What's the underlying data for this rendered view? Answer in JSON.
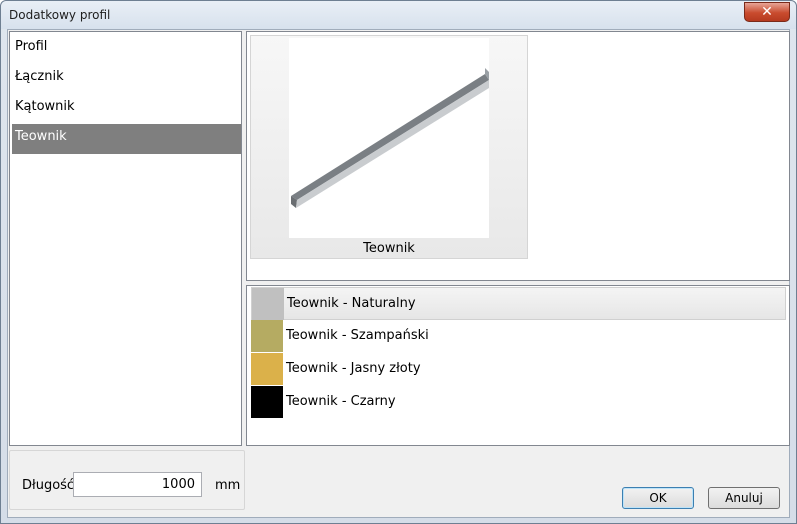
{
  "window": {
    "title": "Dodatkowy profil",
    "close_symbol": "✕"
  },
  "profile_list": {
    "items": [
      {
        "label": "Profil",
        "selected": false
      },
      {
        "label": "Łącznik",
        "selected": false
      },
      {
        "label": "Kątownik",
        "selected": false
      },
      {
        "label": "Teownik",
        "selected": true
      }
    ]
  },
  "preview": {
    "label": "Teownik"
  },
  "variants": [
    {
      "label": "Teownik - Naturalny",
      "color": "#c0c0c0",
      "selected": true
    },
    {
      "label": "Teownik - Szampański",
      "color": "#b5ab62",
      "selected": false
    },
    {
      "label": "Teownik - Jasny złoty",
      "color": "#dbb14a",
      "selected": false
    },
    {
      "label": "Teownik - Czarny",
      "color": "#000000",
      "selected": false
    }
  ],
  "length": {
    "label": "Długość",
    "value": "1000",
    "unit": "mm"
  },
  "buttons": {
    "ok": "OK",
    "cancel": "Anuluj"
  }
}
